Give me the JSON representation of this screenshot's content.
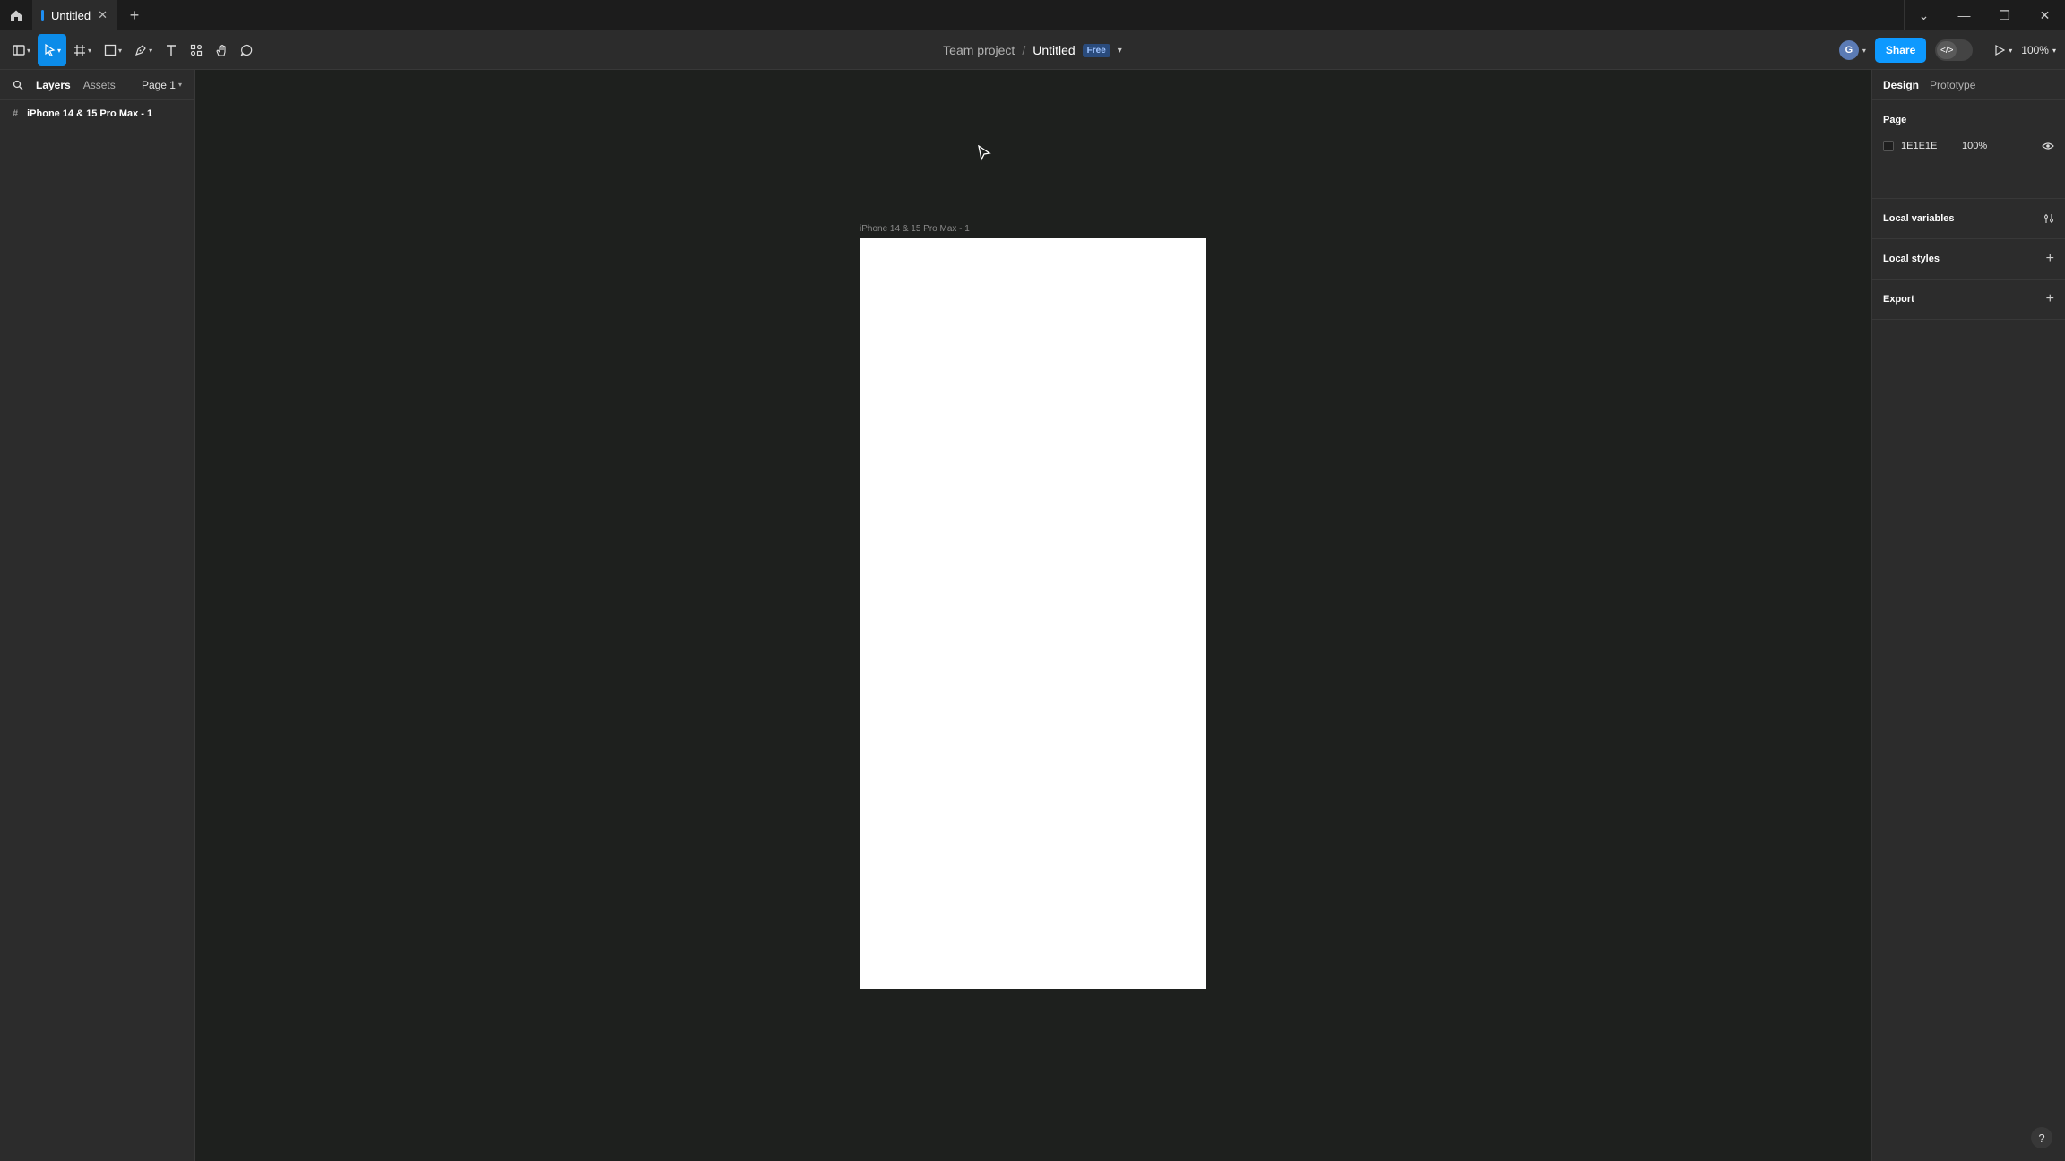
{
  "tab": {
    "title": "Untitled",
    "close": "✕",
    "new": "+"
  },
  "window": {
    "menu": "⌄",
    "minimize": "—",
    "restore": "❐",
    "close": "✕"
  },
  "breadcrumb": {
    "project": "Team project",
    "separator": "/",
    "file": "Untitled",
    "plan_badge": "Free"
  },
  "toolbar": {
    "share_label": "Share",
    "avatar_initial": "G",
    "zoom": "100%",
    "dev_mode_icon": "</>"
  },
  "left_panel": {
    "tabs": [
      "Layers",
      "Assets"
    ],
    "page_selector": "Page 1",
    "layers": [
      {
        "name": "iPhone 14 & 15 Pro Max - 1",
        "icon": "#"
      }
    ]
  },
  "canvas": {
    "frame_label": "iPhone 14 & 15 Pro Max - 1",
    "frame_color": "#FFFFFF",
    "background": "#1E201E"
  },
  "right_panel": {
    "tabs": [
      "Design",
      "Prototype"
    ],
    "page_section": {
      "title": "Page",
      "color_hex": "1E1E1E",
      "opacity": "100%"
    },
    "local_variables": "Local variables",
    "local_styles": "Local styles",
    "export": "Export",
    "add": "+"
  },
  "help": "?"
}
